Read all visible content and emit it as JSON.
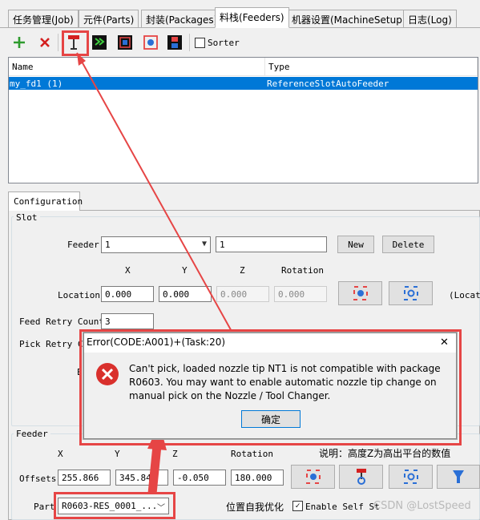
{
  "tabs": [
    {
      "label": "任务管理(Job)"
    },
    {
      "label": "元件(Parts)"
    },
    {
      "label": "封装(Packages)"
    },
    {
      "label": "料栈(Feeders)"
    },
    {
      "label": "机器设置(MachineSetup)"
    },
    {
      "label": "日志(Log)"
    }
  ],
  "toolbar": {
    "add_icon": "plus-icon",
    "remove_icon": "x-icon",
    "sorter_label": "Sorter",
    "sorter_checked": false
  },
  "table": {
    "headers": [
      "Name",
      "Type"
    ],
    "rows": [
      {
        "name": "my_fd1 (1)",
        "type": "ReferenceSlotAutoFeeder",
        "selected": true
      }
    ]
  },
  "config_tab": "Configuration",
  "slot": {
    "title": "Slot",
    "feeder_label": "Feeder",
    "feeder_value": "1",
    "feeder_name": "1",
    "new_label": "New",
    "delete_label": "Delete",
    "col_x": "X",
    "col_y": "Y",
    "col_z": "Z",
    "col_rot": "Rotation",
    "location_label": "Location",
    "loc_x": "0.000",
    "loc_y": "0.000",
    "loc_z": "0.000",
    "loc_rot": "0.000",
    "locat_trunc": "(Locat",
    "feed_retry_label": "Feed Retry Count",
    "feed_retry_value": "3",
    "pick_retry_label": "Pick Retry Co",
    "partial_e": "E"
  },
  "feeder": {
    "title": "Feeder",
    "col_x": "X",
    "col_y": "Y",
    "col_z": "Z",
    "col_rot": "Rotation",
    "note": "说明：高度Z为高出平台的数值",
    "offsets_label": "Offsets",
    "off_x": "255.866",
    "off_y": "345.84",
    "off_z": "-0.050",
    "off_rot": "180.000",
    "part_label": "Part",
    "part_value": "R0603-RES_0001_...",
    "self_opt": "位置自我优化",
    "enable_self_label": "Enable Self St",
    "enable_self_checked": true
  },
  "dialog": {
    "title": "Error(CODE:A001)+(Task:20)",
    "close": "✕",
    "message": "Can't pick, loaded nozzle tip NT1 is not compatible with package R0603. You may want to enable automatic nozzle tip change on manual pick on the Nozzle / Tool Changer.",
    "ok": "确定"
  },
  "watermark": "CSDN @LostSpeed",
  "colors": {
    "selection": "#0078d7",
    "highlight": "#e64545",
    "error": "#d9302c"
  }
}
